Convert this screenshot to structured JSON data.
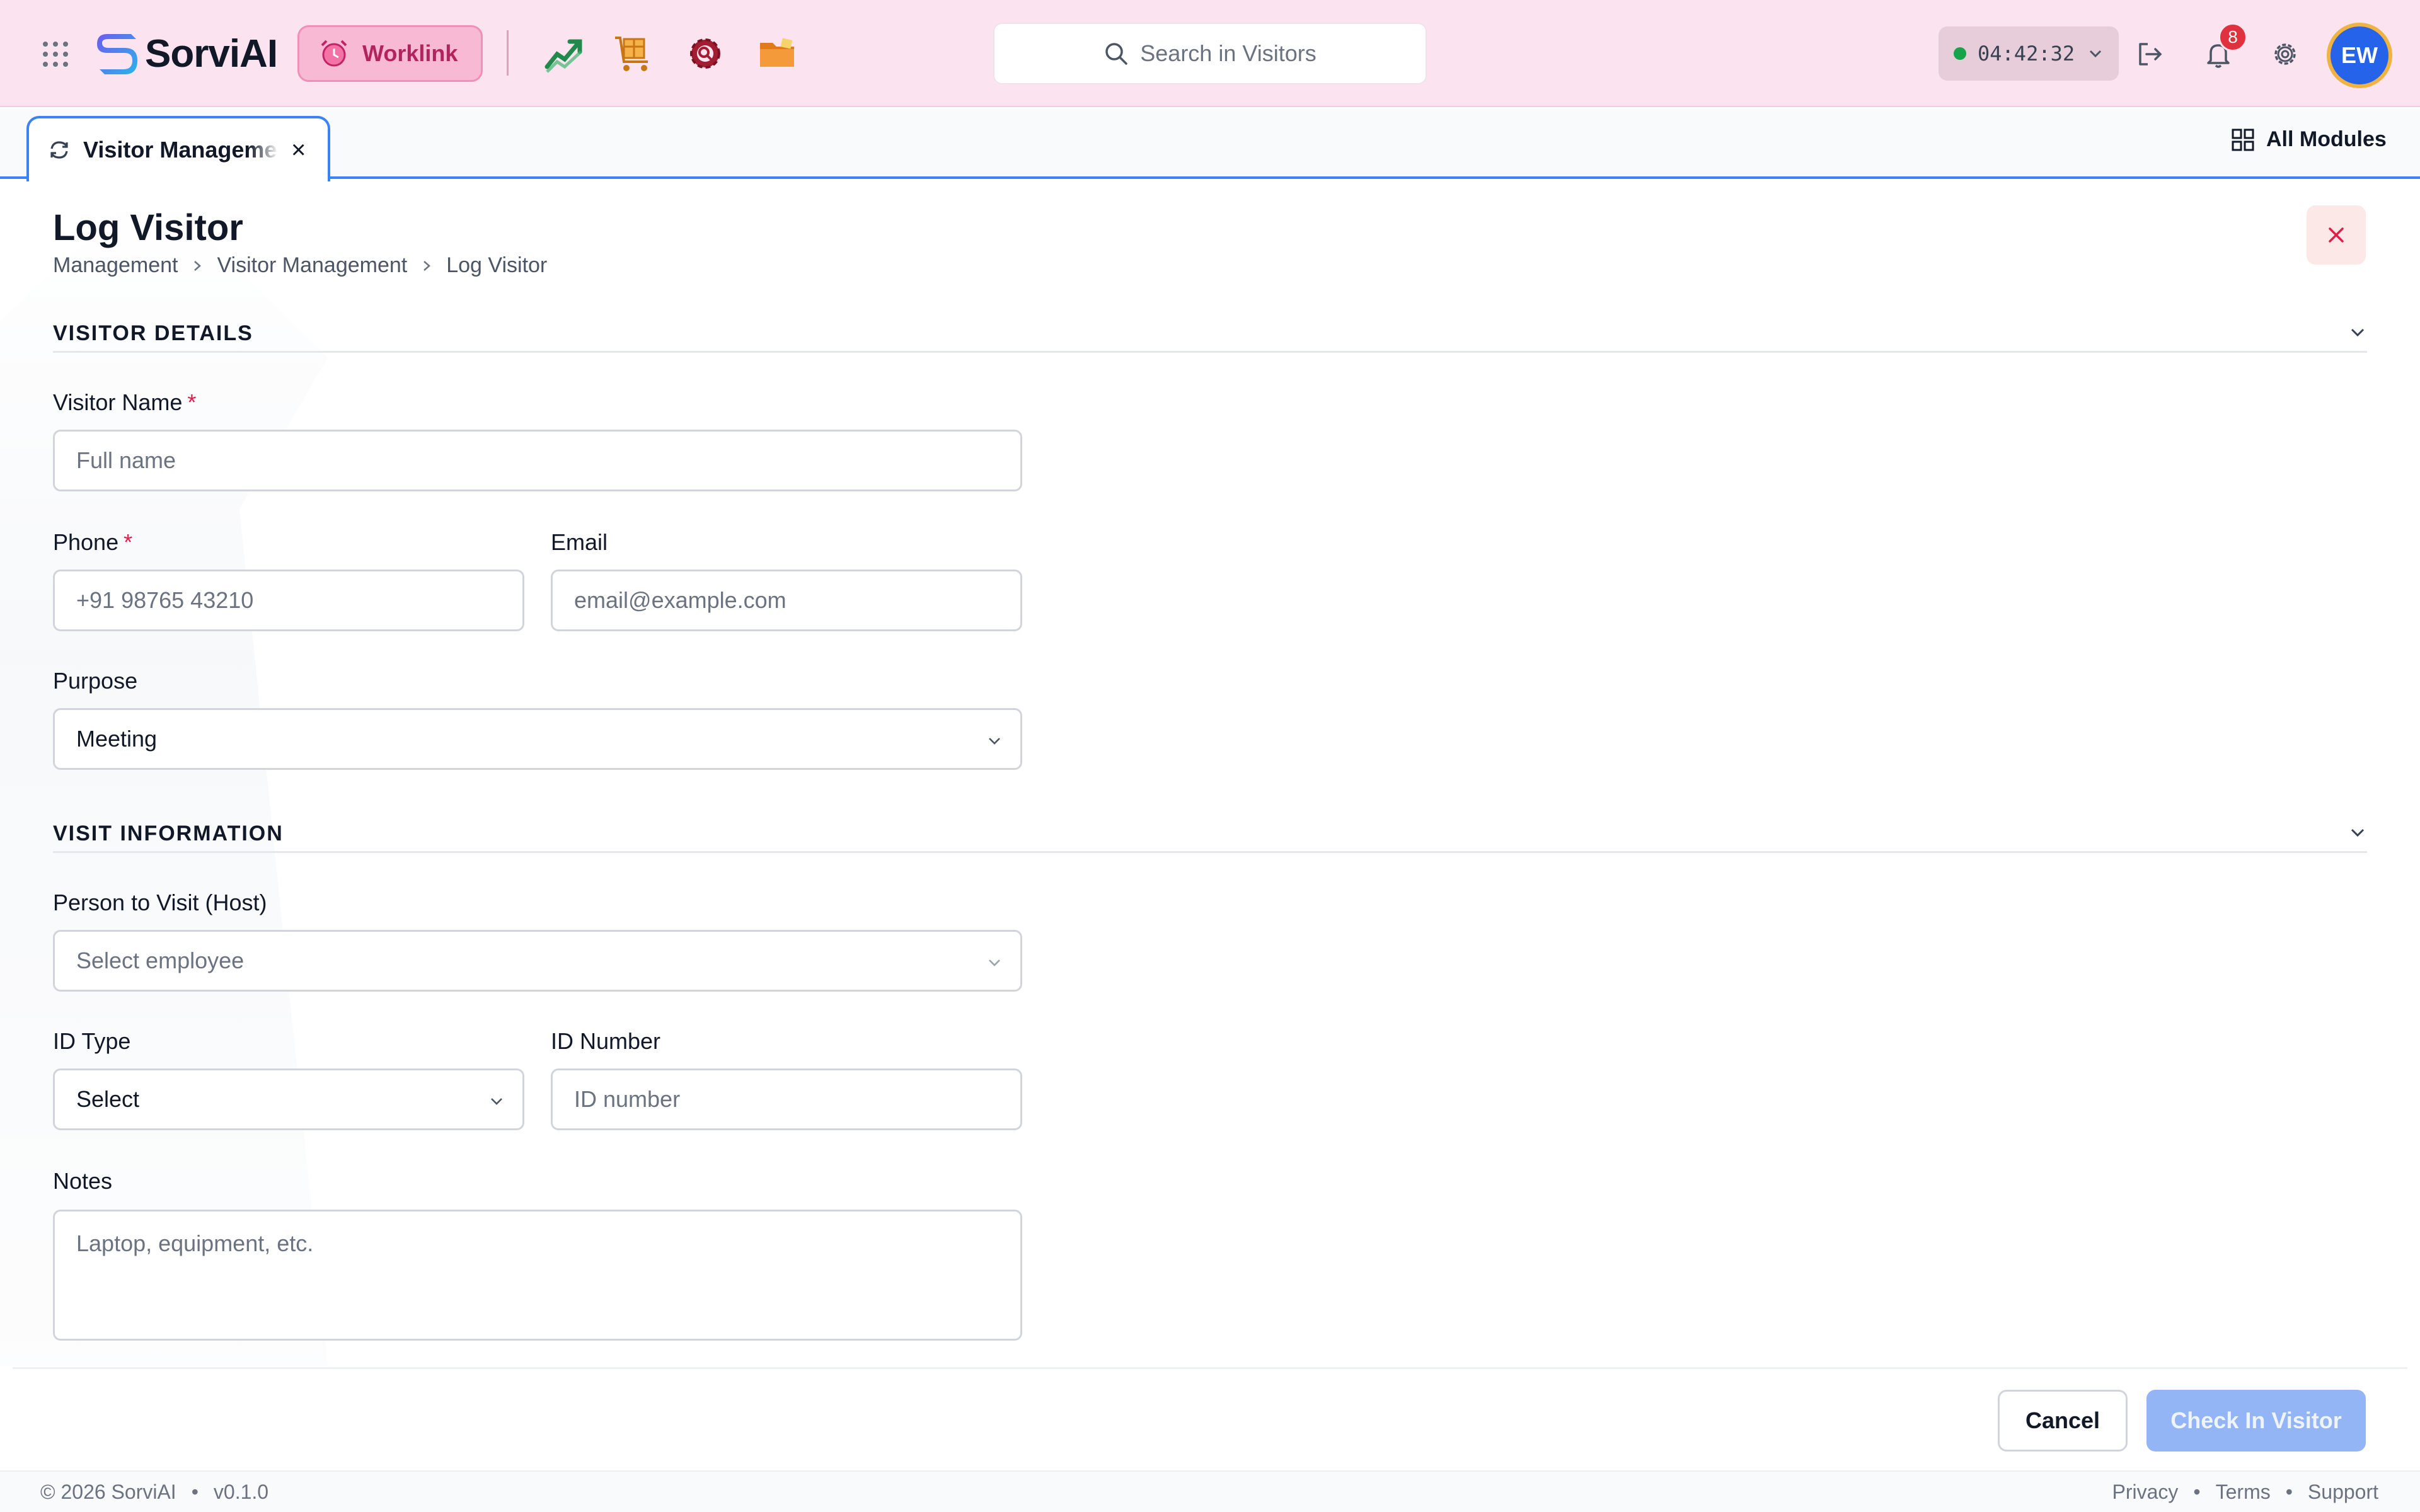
{
  "header": {
    "brand": "SorviAI",
    "workspace_label": "Worklink",
    "search_placeholder": "Search in Visitors",
    "timer": "04:42:32",
    "notification_count": "8",
    "avatar_initials": "EW",
    "apps": [
      "trending-chart-icon",
      "package-cart-icon",
      "gear-search-icon",
      "folder-icon"
    ],
    "colors": {
      "topbar": "#fbe4ef",
      "worklink": "#f7b9d3",
      "accent": "#3b82f6",
      "avatar": "#2563eb"
    }
  },
  "tabs": {
    "active_tab": "Visitor Management",
    "all_modules": "All Modules"
  },
  "page": {
    "title": "Log Visitor",
    "breadcrumb": [
      "Management",
      "Visitor Management",
      "Log Visitor"
    ]
  },
  "sections": {
    "visitor_details": "VISITOR DETAILS",
    "visit_information": "VISIT INFORMATION"
  },
  "form": {
    "visitor_name": {
      "label": "Visitor Name",
      "required": "*",
      "placeholder": "Full name"
    },
    "phone": {
      "label": "Phone",
      "required": "*",
      "placeholder": "+91 98765 43210"
    },
    "email": {
      "label": "Email",
      "placeholder": "email@example.com"
    },
    "purpose": {
      "label": "Purpose",
      "value": "Meeting"
    },
    "host": {
      "label": "Person to Visit (Host)",
      "placeholder": "Select employee"
    },
    "id_type": {
      "label": "ID Type",
      "value": "Select"
    },
    "id_number": {
      "label": "ID Number",
      "placeholder": "ID number"
    },
    "notes": {
      "label": "Notes",
      "placeholder": "Laptop, equipment, etc."
    }
  },
  "actions": {
    "cancel": "Cancel",
    "check_in": "Check In Visitor"
  },
  "footer": {
    "copyright": "© 2026 SorviAI",
    "version": "v0.1.0",
    "links": [
      "Privacy",
      "Terms",
      "Support"
    ]
  }
}
